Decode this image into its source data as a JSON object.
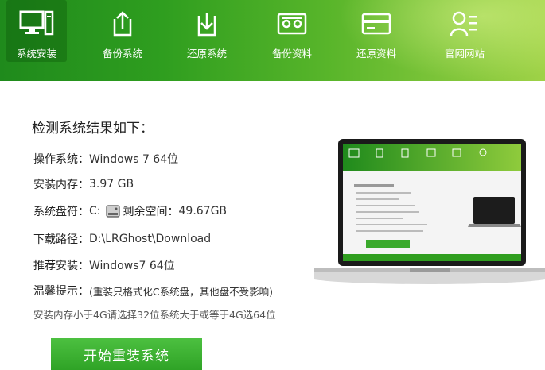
{
  "nav": [
    {
      "label": "系统安装",
      "icon": "monitor-pc-icon",
      "active": true
    },
    {
      "label": "备份系统",
      "icon": "upload-icon",
      "active": false
    },
    {
      "label": "还原系统",
      "icon": "download-icon",
      "active": false
    },
    {
      "label": "备份资料",
      "icon": "cassette-icon",
      "active": false
    },
    {
      "label": "还原资料",
      "icon": "card-icon",
      "active": false
    },
    {
      "label": "官网网站",
      "icon": "user-list-icon",
      "active": false
    }
  ],
  "main": {
    "title": "检测系统结果如下：",
    "os": {
      "label": "操作系统：",
      "value": "Windows 7 64位"
    },
    "memory": {
      "label": "安装内存：",
      "value": "3.97 GB"
    },
    "disk": {
      "label": "系统盘符：",
      "drive": "C:",
      "free_label": "剩余空间：",
      "free_value": "49.67GB"
    },
    "download": {
      "label": "下载路径：",
      "value": "D:\\LRGhost\\Download"
    },
    "recommend": {
      "label": "推荐安装：",
      "value": "Windows7 64位"
    },
    "tip": {
      "label": "温馨提示：",
      "value": "(重装只格式化C系统盘，其他盘不受影响)"
    },
    "hint": "安装内存小于4G请选择32位系统大于或等于4G选64位",
    "start_button": "开始重装系统"
  },
  "colors": {
    "accent": "#3aa92c",
    "banner_start": "#1f8a1c",
    "banner_end": "#9fd247"
  }
}
